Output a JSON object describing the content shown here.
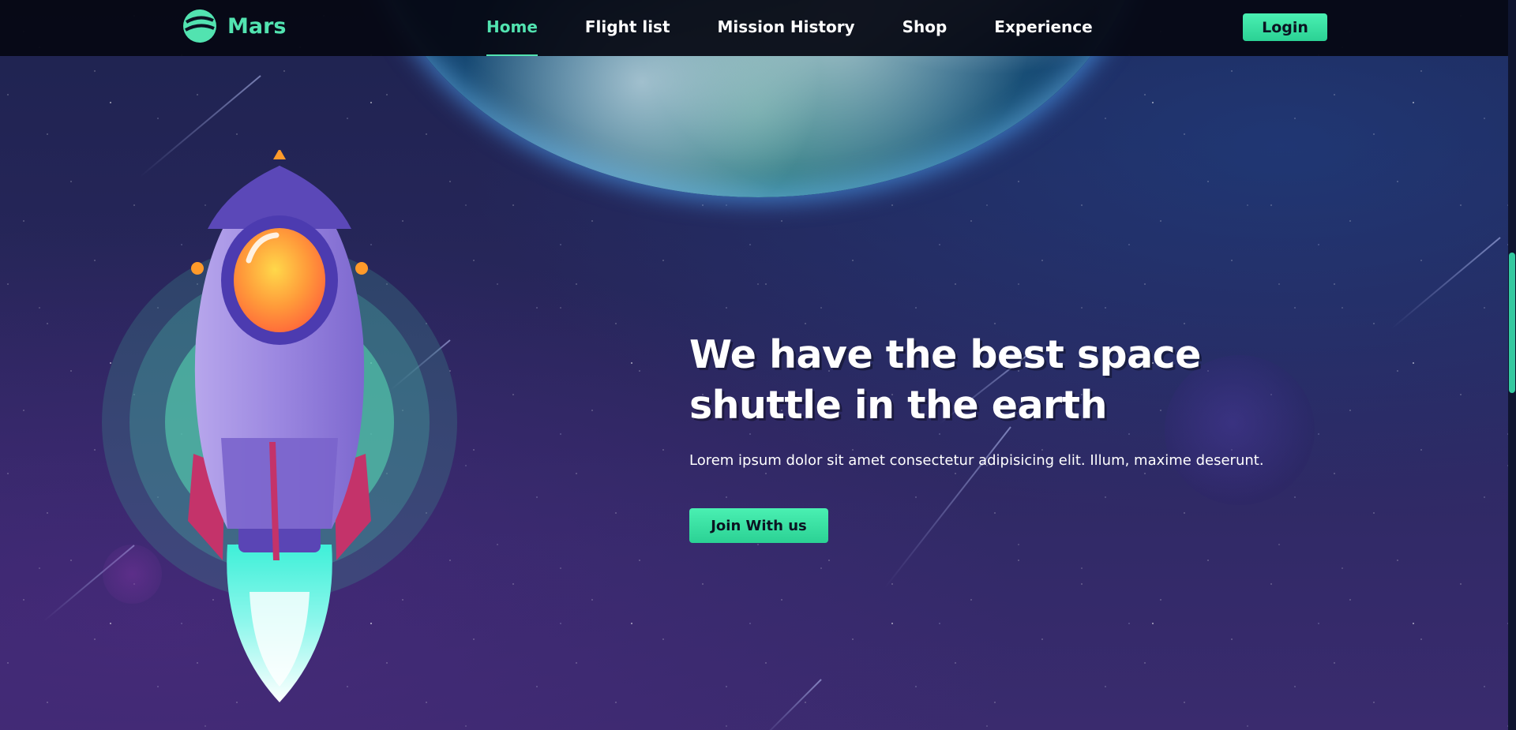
{
  "brand": {
    "name": "Mars",
    "logo_icon": "planet-logo-icon"
  },
  "nav": {
    "items": [
      {
        "label": "Home",
        "active": true
      },
      {
        "label": "Flight list",
        "active": false
      },
      {
        "label": "Mission History",
        "active": false
      },
      {
        "label": "Shop",
        "active": false
      },
      {
        "label": "Experience",
        "active": false
      }
    ],
    "login_label": "Login"
  },
  "hero": {
    "title": "We have the best space shuttle in the earth",
    "subtitle": "Lorem ipsum dolor sit amet consectetur adipisicing elit. Illum, maxime deserunt.",
    "cta_label": "Join With us"
  },
  "colors": {
    "accent": "#52e3b0",
    "button": "#3ee6a8",
    "navbar_bg": "#05080f",
    "background_top": "#1e2350",
    "background_bottom": "#3a2b6e"
  }
}
